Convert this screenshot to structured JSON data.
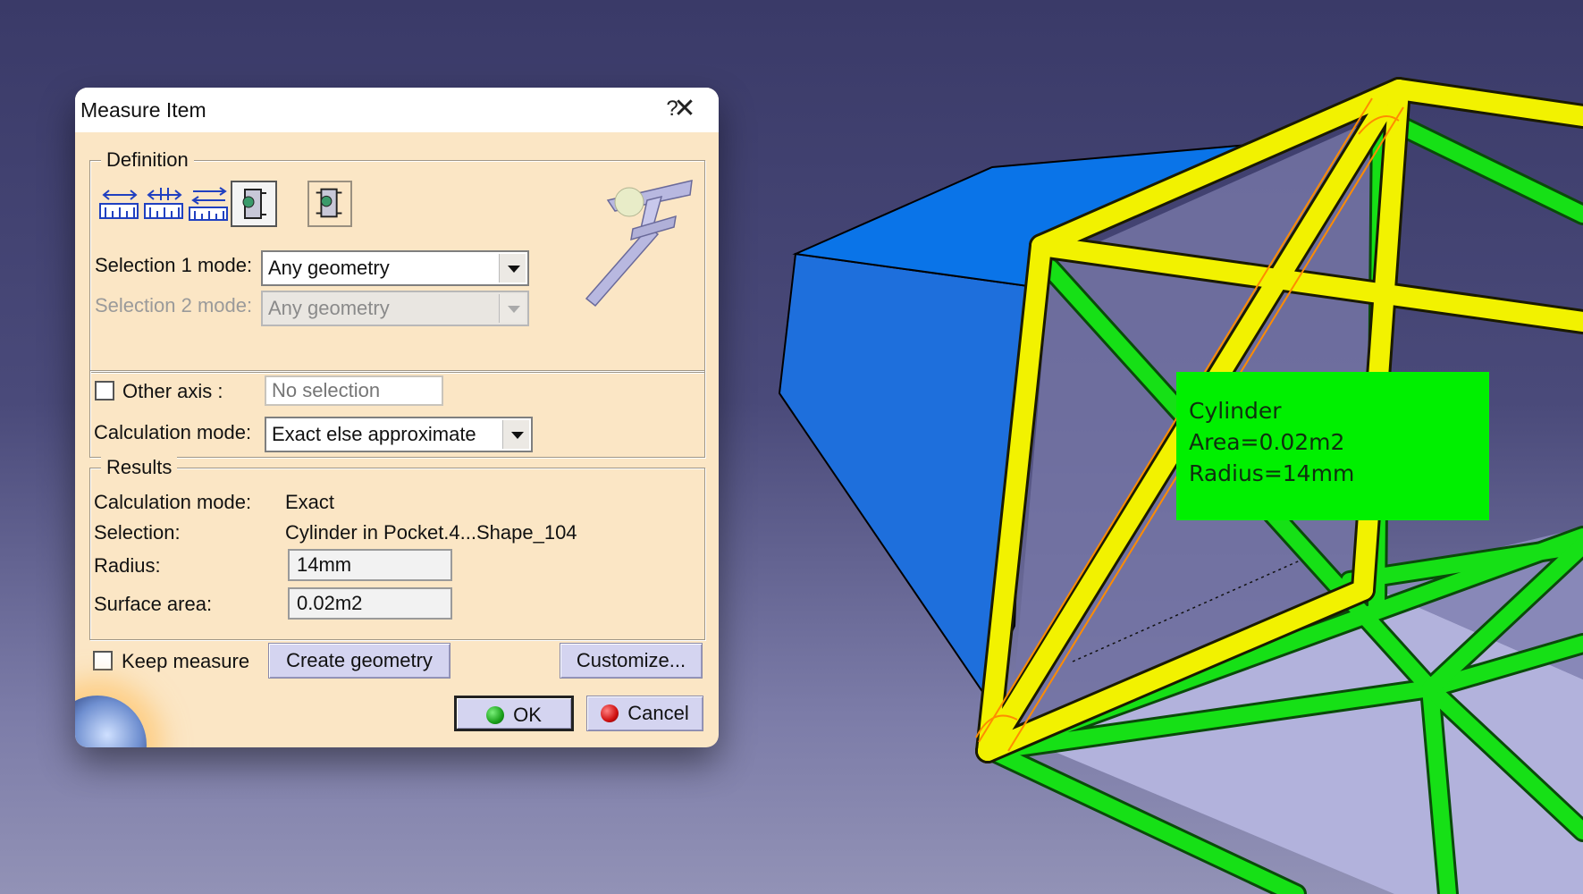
{
  "dialog": {
    "title": "Measure Item",
    "help_glyph": "?",
    "close_glyph": "✕",
    "definition": {
      "legend": "Definition",
      "tool_icons": [
        "measure-item-icon",
        "measure-thickness-icon",
        "measure-item-between-icon",
        "measure-item-active-icon",
        "measure-customize-icon"
      ],
      "selection1_label": "Selection 1 mode:",
      "selection1_value": "Any geometry",
      "selection2_label": "Selection 2 mode:",
      "selection2_value": "Any geometry",
      "other_axis_label": "Other axis :",
      "other_axis_placeholder": "No selection",
      "calc_mode_label": "Calculation mode:",
      "calc_mode_value": "Exact else approximate"
    },
    "results": {
      "legend": "Results",
      "calc_mode_label": "Calculation mode:",
      "calc_mode_value": "Exact",
      "selection_label": "Selection:",
      "selection_value": "Cylinder in Pocket.4...Shape_104",
      "radius_label": "Radius:",
      "radius_value": "14mm",
      "surface_label": "Surface area:",
      "surface_value": "0.02m2"
    },
    "keep_measure_label": "Keep measure",
    "create_geometry_label": "Create geometry",
    "customize_label": "Customize...",
    "ok_label": "OK",
    "cancel_label": "Cancel",
    "colors": {
      "ok_dot": "#1aa01a",
      "cancel_dot": "#d01010"
    }
  },
  "annotation": {
    "line1": "Cylinder",
    "line2": "Area=0.02m2",
    "line3": "Radius=14mm",
    "color": "#00f000"
  }
}
